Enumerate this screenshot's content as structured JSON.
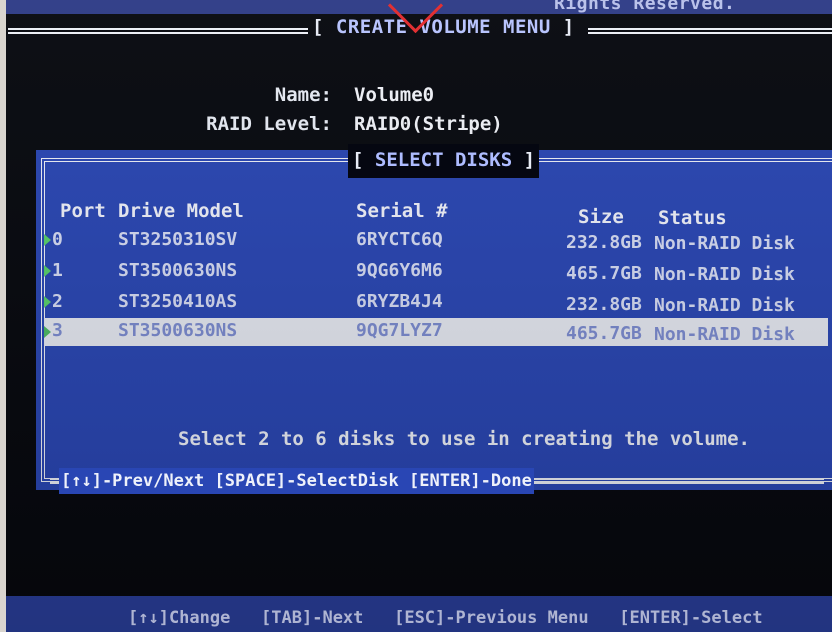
{
  "screen": {
    "top_copyright_fragment": "Rights Reserved.",
    "menu_title_left": "[",
    "menu_title": "CREATE VOLUME MENU",
    "menu_title_right": "]"
  },
  "volume": {
    "name_label": "Name:",
    "name_value": "Volume0",
    "raid_level_label": "RAID Level:",
    "raid_level_value": "RAID0(Stripe)"
  },
  "select_disks": {
    "title_left": "[",
    "title": "SELECT DISKS",
    "title_right": "]",
    "columns": [
      "Port",
      "Drive Model",
      "Serial #",
      "Size",
      "Status"
    ],
    "rows": [
      {
        "port": "0",
        "model": "ST3250310SV",
        "serial": "6RYCTC6Q",
        "size": "232.8GB",
        "status": "Non-RAID Disk",
        "selected": false
      },
      {
        "port": "1",
        "model": "ST3500630NS",
        "serial": "9QG6Y6M6",
        "size": "465.7GB",
        "status": "Non-RAID Disk",
        "selected": false
      },
      {
        "port": "2",
        "model": "ST3250410AS",
        "serial": "6RYZB4J4",
        "size": "232.8GB",
        "status": "Non-RAID Disk",
        "selected": false
      },
      {
        "port": "3",
        "model": "ST3500630NS",
        "serial": "9QG7LYZ7",
        "size": "465.7GB",
        "status": "Non-RAID Disk",
        "selected": true
      }
    ],
    "instruction": "Select 2 to 6 disks to use in creating the volume.",
    "hints": "[↑↓]-Prev/Next [SPACE]-SelectDisk [ENTER]-Done"
  },
  "bottom_bar": {
    "text": "[↑↓]Change   [TAB]-Next   [ESC]-Previous Menu   [ENTER]-Select"
  },
  "colors": {
    "bios_blue": "#2946b4",
    "screen_black": "#06080e",
    "selection": "#e6e9f2",
    "port_arrow": "#58d06b",
    "marker_red": "#e23033"
  }
}
